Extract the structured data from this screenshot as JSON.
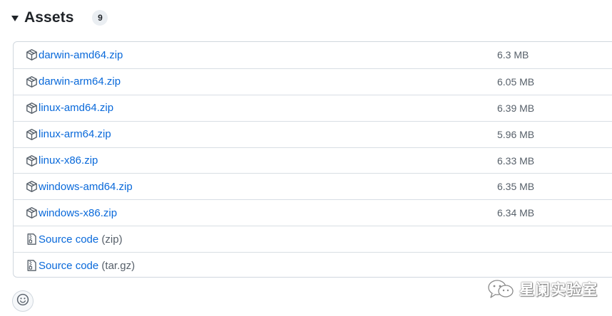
{
  "assets": {
    "title": "Assets",
    "count": "9",
    "items": [
      {
        "name": "darwin-amd64.zip",
        "ext": "",
        "size": "6.3 MB",
        "icon": "package-icon"
      },
      {
        "name": "darwin-arm64.zip",
        "ext": "",
        "size": "6.05 MB",
        "icon": "package-icon"
      },
      {
        "name": "linux-amd64.zip",
        "ext": "",
        "size": "6.39 MB",
        "icon": "package-icon"
      },
      {
        "name": "linux-arm64.zip",
        "ext": "",
        "size": "5.96 MB",
        "icon": "package-icon"
      },
      {
        "name": "linux-x86.zip",
        "ext": "",
        "size": "6.33 MB",
        "icon": "package-icon"
      },
      {
        "name": "windows-amd64.zip",
        "ext": "",
        "size": "6.35 MB",
        "icon": "package-icon"
      },
      {
        "name": "windows-x86.zip",
        "ext": "",
        "size": "6.34 MB",
        "icon": "package-icon"
      },
      {
        "name": "Source code",
        "ext": "(zip)",
        "size": "",
        "icon": "file-zip-icon"
      },
      {
        "name": "Source code",
        "ext": "(tar.gz)",
        "size": "",
        "icon": "file-zip-icon"
      }
    ]
  },
  "reaction": {
    "icon": "smiley-icon"
  },
  "watermark": {
    "text": "星阑实验室",
    "icon": "wechat-icon"
  },
  "colors": {
    "link": "#0969da",
    "muted": "#57606a",
    "border": "#d0d7de"
  }
}
